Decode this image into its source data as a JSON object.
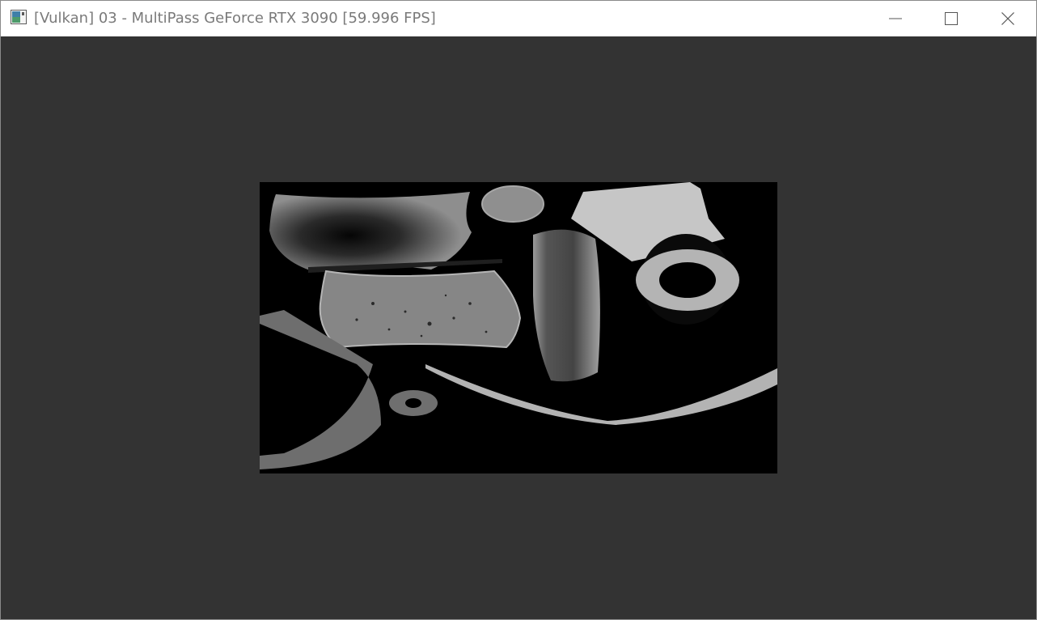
{
  "window": {
    "title": "[Vulkan] 03 - MultiPass GeForce RTX 3090 [59.996 FPS]",
    "icons": {
      "app": "application-window-icon",
      "minimize": "minimize-icon",
      "maximize": "maximize-icon",
      "close": "close-icon"
    }
  },
  "colors": {
    "titlebar_bg": "#ffffff",
    "title_text": "#7a7a7a",
    "client_bg": "#333333",
    "render_bg": "#000000",
    "texture_gray": "#9a9a9a"
  }
}
